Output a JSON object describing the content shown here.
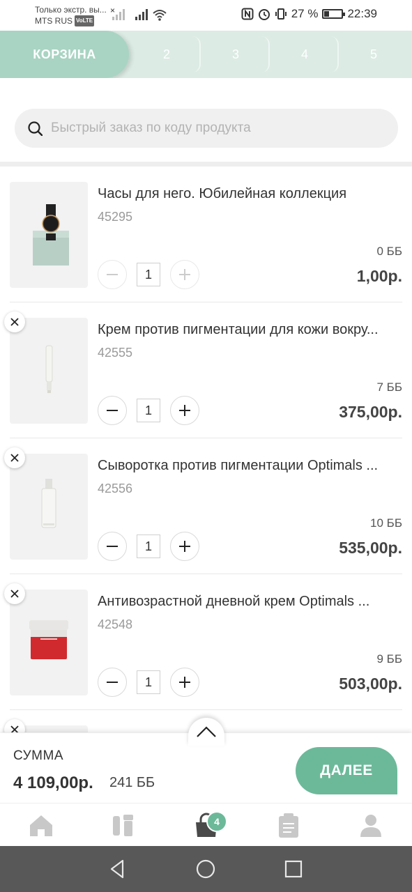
{
  "status_bar": {
    "notification_line1": "Только экстр. вы...",
    "carrier": "MTS RUS",
    "volte": "VoLTE",
    "battery_percent": "27 %",
    "time": "22:39",
    "icons": [
      "signal-icon",
      "wifi-icon",
      "nfc-icon",
      "alarm-icon",
      "vibrate-icon",
      "battery-icon"
    ]
  },
  "stepper": {
    "active_label": "КОРЗИНА",
    "steps": [
      "2",
      "3",
      "4",
      "5"
    ]
  },
  "search": {
    "placeholder": "Быстрый заказ по коду продукта"
  },
  "items": [
    {
      "title": "Часы для него. Юбилейная коллекция",
      "code": "45295",
      "bb": "0 ББ",
      "price": "1,00р.",
      "qty": "1",
      "removable": false,
      "minus_disabled": true,
      "plus_disabled": true,
      "image": "watch"
    },
    {
      "title": "Крем против пигментации для кожи вокру...",
      "code": "42555",
      "bb": "7 ББ",
      "price": "375,00р.",
      "qty": "1",
      "removable": true,
      "minus_disabled": false,
      "plus_disabled": false,
      "image": "tube"
    },
    {
      "title": "Сыворотка против пигментации Optimals ...",
      "code": "42556",
      "bb": "10 ББ",
      "price": "535,00р.",
      "qty": "1",
      "removable": true,
      "minus_disabled": false,
      "plus_disabled": false,
      "image": "bottle"
    },
    {
      "title": "Антивозрастной дневной крем Optimals ...",
      "code": "42548",
      "bb": "9 ББ",
      "price": "503,00р.",
      "qty": "1",
      "removable": true,
      "minus_disabled": false,
      "plus_disabled": false,
      "image": "jar"
    }
  ],
  "summary": {
    "label": "СУММА",
    "total": "4 109,00р.",
    "bb_total": "241 ББ",
    "next_label": "ДАЛЕЕ"
  },
  "bottom_nav": {
    "cart_badge": "4",
    "items": [
      "home-icon",
      "catalog-icon",
      "cart-icon",
      "orders-icon",
      "profile-icon"
    ]
  },
  "colors": {
    "accent": "#6cb99a",
    "stepper_bg": "#dcebe4",
    "stepper_active": "#a9d4c3",
    "android_nav": "#585858"
  }
}
